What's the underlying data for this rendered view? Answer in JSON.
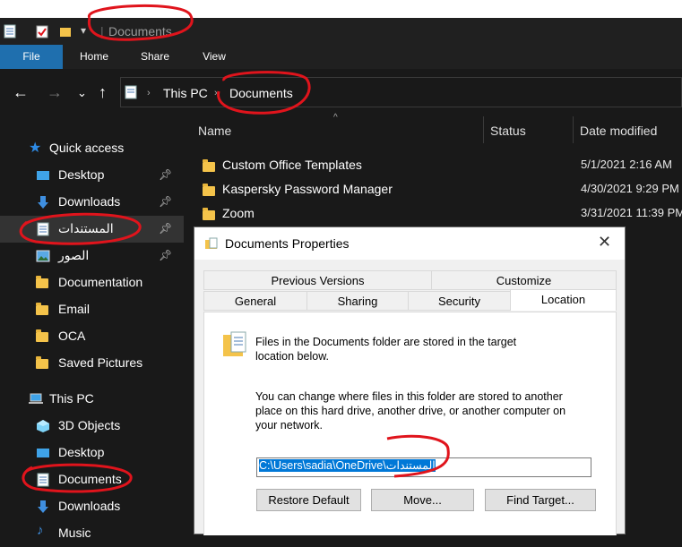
{
  "window": {
    "title": "Documents"
  },
  "ribbon": {
    "tabs": [
      "File",
      "Home",
      "Share",
      "View"
    ]
  },
  "breadcrumb": [
    "This PC",
    "Documents"
  ],
  "sidebar": {
    "quick_access": "Quick access",
    "items": [
      {
        "label": "Desktop",
        "icon": "desktop-icon",
        "pinned": true
      },
      {
        "label": "Downloads",
        "icon": "download-arrow-icon",
        "pinned": true
      },
      {
        "label": "المستندات",
        "icon": "document-icon",
        "pinned": true
      },
      {
        "label": "الصور",
        "icon": "pictures-icon",
        "pinned": true
      },
      {
        "label": "Documentation",
        "icon": "folder-icon",
        "pinned": false
      },
      {
        "label": "Email",
        "icon": "folder-icon",
        "pinned": false
      },
      {
        "label": "OCA",
        "icon": "folder-icon",
        "pinned": false
      },
      {
        "label": "Saved Pictures",
        "icon": "folder-icon",
        "pinned": false
      }
    ],
    "this_pc": "This PC",
    "pc_items": [
      {
        "label": "3D Objects",
        "icon": "3d-objects-icon"
      },
      {
        "label": "Desktop",
        "icon": "desktop-icon"
      },
      {
        "label": "Documents",
        "icon": "document-icon"
      },
      {
        "label": "Downloads",
        "icon": "download-arrow-icon"
      },
      {
        "label": "Music",
        "icon": "music-icon"
      }
    ]
  },
  "columns": {
    "name": "Name",
    "status": "Status",
    "date": "Date modified"
  },
  "files": [
    {
      "name": "Custom Office Templates",
      "date": "5/1/2021 2:16 AM"
    },
    {
      "name": "Kaspersky Password Manager",
      "date": "4/30/2021 9:29 PM"
    },
    {
      "name": "Zoom",
      "date": "3/31/2021 11:39 PM"
    }
  ],
  "dialog": {
    "title": "Documents Properties",
    "tabs_row1": [
      "Previous Versions",
      "Customize"
    ],
    "tabs_row2": [
      "General",
      "Sharing",
      "Security",
      "Location"
    ],
    "info_text_line1": "Files in the Documents folder are stored in the target",
    "info_text_line2": "location below.",
    "change_line1": "You can change where files in this folder are stored to another",
    "change_line2": "place on this hard drive, another drive, or another computer on",
    "change_line3": "your network.",
    "path_value": "C:\\Users\\sadia\\OneDrive\\المستندات",
    "buttons": {
      "restore": "Restore Default",
      "move": "Move...",
      "find": "Find Target..."
    }
  },
  "colors": {
    "accent": "#1f6fae",
    "annotation": "#e0141c",
    "selection": "#0078d7"
  }
}
